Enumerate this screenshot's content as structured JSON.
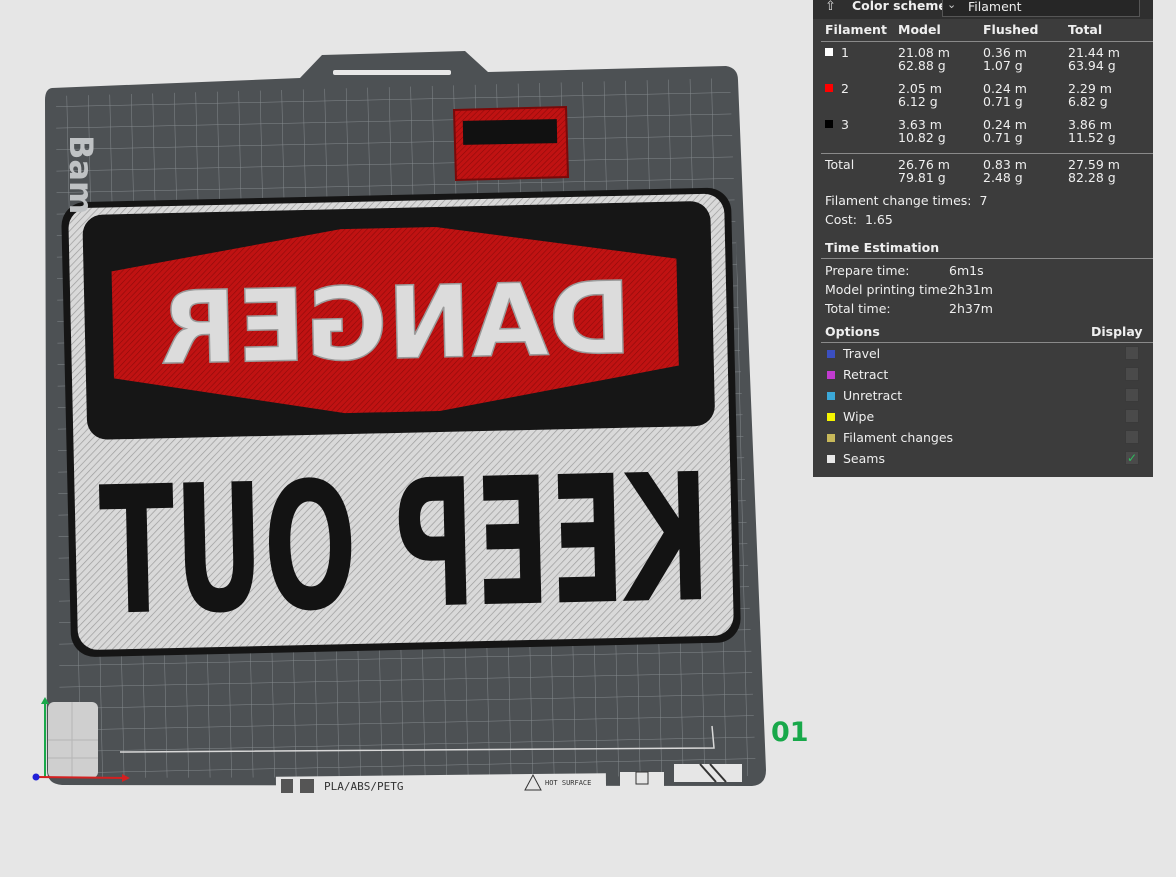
{
  "viewport": {
    "plate_number": "01",
    "bed_text": "Bam",
    "plate_badge_material": "PLA/ABS/PETG",
    "plate_badge_warning": "HOT SURFACE",
    "model_text_top": "DANGER",
    "model_text_bottom": "KEEP OUT"
  },
  "panel": {
    "color_scheme_label": "Color scheme",
    "color_scheme_value": "Filament",
    "headers": [
      "Filament",
      "Model",
      "Flushed",
      "Total"
    ],
    "filaments": [
      {
        "id": "1",
        "color": "#ffffff",
        "model": [
          "21.08 m",
          "62.88 g"
        ],
        "flushed": [
          "0.36 m",
          "1.07 g"
        ],
        "total": [
          "21.44 m",
          "63.94 g"
        ]
      },
      {
        "id": "2",
        "color": "#ff0000",
        "model": [
          "2.05 m",
          "6.12 g"
        ],
        "flushed": [
          "0.24 m",
          "0.71 g"
        ],
        "total": [
          "2.29 m",
          "6.82 g"
        ]
      },
      {
        "id": "3",
        "color": "#000000",
        "model": [
          "3.63 m",
          "10.82 g"
        ],
        "flushed": [
          "0.24 m",
          "0.71 g"
        ],
        "total": [
          "3.86 m",
          "11.52 g"
        ]
      }
    ],
    "total": {
      "label": "Total",
      "model": [
        "26.76 m",
        "79.81 g"
      ],
      "flushed": [
        "0.83 m",
        "2.48 g"
      ],
      "total": [
        "27.59 m",
        "82.28 g"
      ]
    },
    "change_times_label": "Filament change times:",
    "change_times_value": "7",
    "cost_label": "Cost:",
    "cost_value": "1.65",
    "time_section": "Time Estimation",
    "prepare_label": "Prepare time:",
    "prepare_value": "6m1s",
    "model_print_label": "Model printing time:",
    "model_print_value": "2h31m",
    "total_time_label": "Total time:",
    "total_time_value": "2h37m",
    "options_label": "Options",
    "display_label": "Display",
    "options": [
      {
        "name": "Travel",
        "color": "#3b4fc0",
        "checked": false
      },
      {
        "name": "Retract",
        "color": "#c23bd0",
        "checked": false
      },
      {
        "name": "Unretract",
        "color": "#3ba8d8",
        "checked": false
      },
      {
        "name": "Wipe",
        "color": "#f5f500",
        "checked": false
      },
      {
        "name": "Filament changes",
        "color": "#c8b95a",
        "checked": false
      },
      {
        "name": "Seams",
        "color": "#e8e8e8",
        "checked": true
      }
    ]
  }
}
